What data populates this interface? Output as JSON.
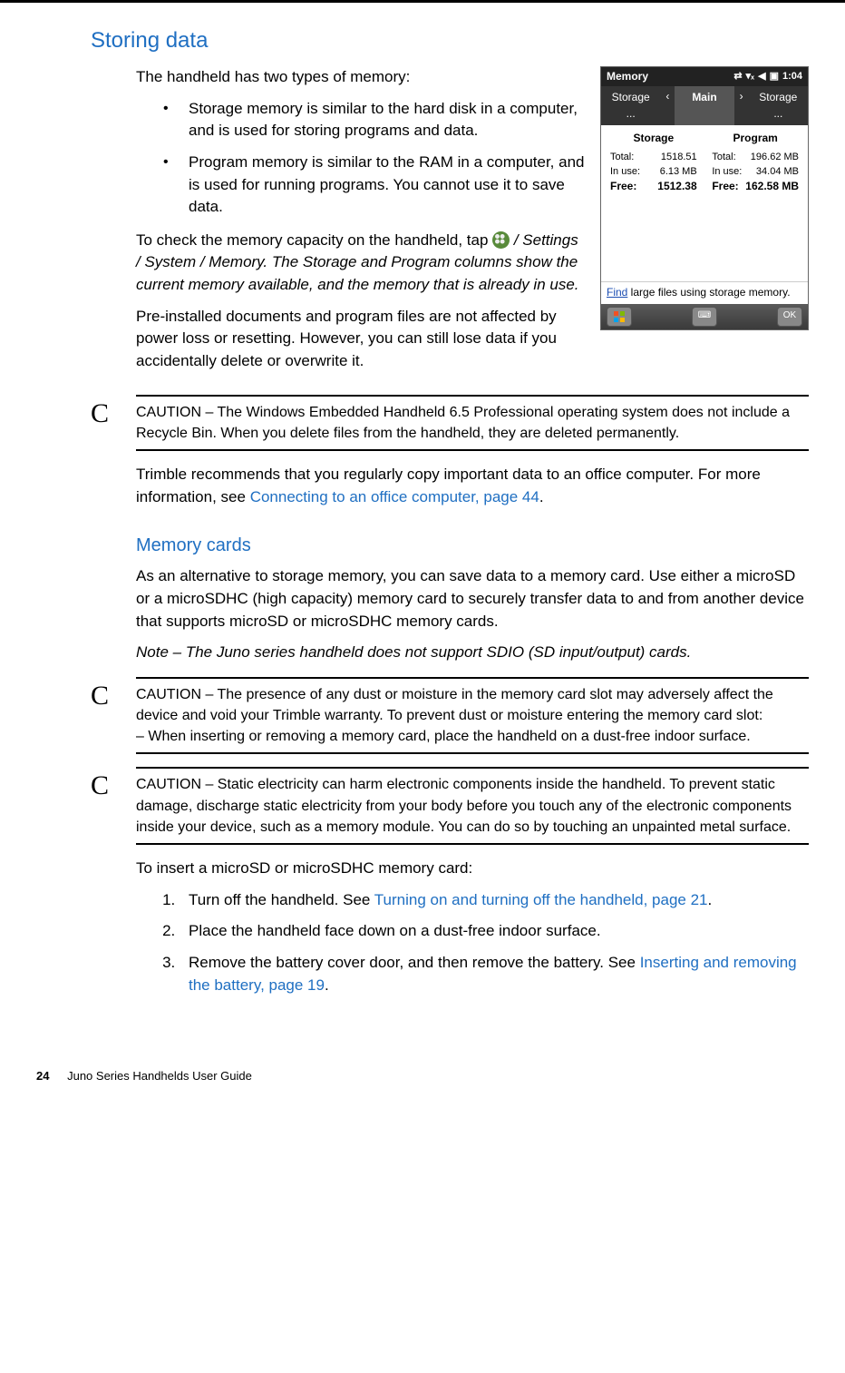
{
  "section_title": "Storing data",
  "intro": "The handheld has two types of memory:",
  "bullets": [
    "Storage memory is similar to the hard disk in a computer, and is used for storing programs and data.",
    "Program memory is similar to the RAM in a computer, and is used for running programs. You cannot use it to save data."
  ],
  "check_memory_pre": "To check the memory capacity on the handheld, tap ",
  "check_memory_post": " / Settings / System / Memory. The Storage and Program columns show the current memory available, and the memory that is already in use.",
  "preinstalled": "Pre-installed documents and program files are not affected by power loss or resetting. However, you can still lose data if you accidentally delete or overwrite it.",
  "caution1": "CAUTION – The Windows Embedded Handheld 6.5 Professional operating system does not include a Recycle Bin. When you delete files from the handheld, they are deleted permanently.",
  "recommend_pre": "Trimble recommends that you regularly copy important data to an office computer. For more information, see ",
  "recommend_link": "Connecting to an office computer, page 44",
  "recommend_post": ".",
  "memcards_title": "Memory cards",
  "memcards_intro": "As an alternative to storage memory, you can save data to a memory card. Use either a microSD or a microSDHC (high capacity) memory card to securely transfer data to and from another device that supports microSD or microSDHC memory cards.",
  "note": "Note – The Juno series handheld does not support SDIO (SD input/output) cards.",
  "caution2": "CAUTION – The presence of any dust or moisture in the memory card slot may adversely affect the device and void your Trimble warranty. To prevent dust or moisture entering the memory card slot:\n– When inserting or removing a memory card, place the handheld on a dust-free indoor surface.",
  "caution3": "CAUTION – Static electricity can harm electronic components inside the handheld. To prevent static damage, discharge static electricity from your body before you touch any of the electronic components inside your device, such as a memory module. You can do so by touching an unpainted metal surface.",
  "insert_intro": "To insert a microSD or microSDHC memory card:",
  "steps": {
    "s1_pre": "Turn off the handheld. See ",
    "s1_link": "Turning on and turning off the handheld, page 21",
    "s1_post": ".",
    "s2": "Place the handheld face down on a dust-free indoor surface.",
    "s3_pre": "Remove the battery cover door, and then remove the battery. See ",
    "s3_link": "Inserting and removing the battery, page 19",
    "s3_post": "."
  },
  "screenshot": {
    "title": "Memory",
    "time": "1:04",
    "tabs": {
      "left": "Storage ...",
      "center": "Main",
      "right": "Storage ..."
    },
    "storage_label": "Storage",
    "program_label": "Program",
    "storage": {
      "total": "1518.51",
      "inuse": "6.13 MB",
      "free": "1512.38"
    },
    "program": {
      "total": "196.62 MB",
      "inuse": "34.04 MB",
      "free": "162.58 MB"
    },
    "row_labels": {
      "total": "Total:",
      "inuse": "In use:",
      "free": "Free:"
    },
    "link_word": "Find",
    "link_rest": " large files using storage memory.",
    "ok": "OK"
  },
  "footer": {
    "page": "24",
    "guide": "Juno Series Handhelds User Guide"
  },
  "caution_letter": "C"
}
